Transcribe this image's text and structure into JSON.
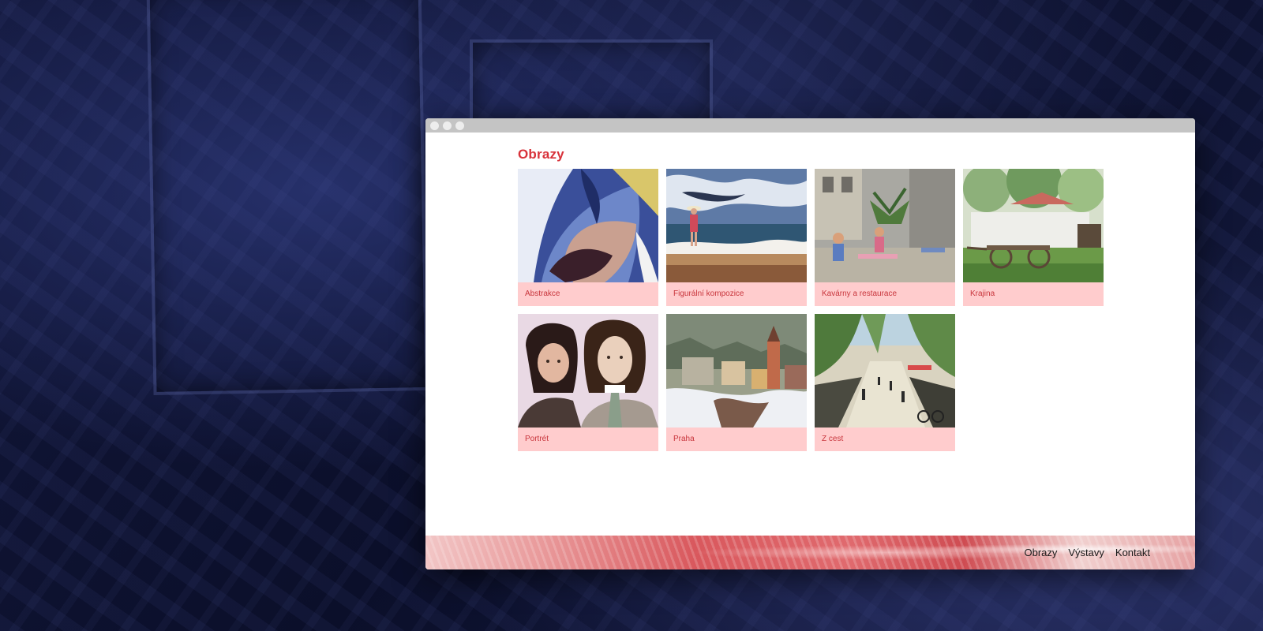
{
  "page": {
    "title": "Obrazy"
  },
  "gallery": {
    "items": [
      {
        "label": "Abstrakce",
        "image": "abstract-painting"
      },
      {
        "label": "Figurální kompozice",
        "image": "beach-figure-painting"
      },
      {
        "label": "Kavárny a restaurace",
        "image": "cafe-painting"
      },
      {
        "label": "Krajina",
        "image": "landscape-painting"
      },
      {
        "label": "Portrét",
        "image": "portrait-painting"
      },
      {
        "label": "Praha",
        "image": "prague-painting"
      },
      {
        "label": "Z cest",
        "image": "travel-street-painting"
      }
    ]
  },
  "footer": {
    "nav": [
      {
        "label": "Obrazy"
      },
      {
        "label": "Výstavy"
      },
      {
        "label": "Kontakt"
      }
    ]
  },
  "colors": {
    "accent": "#d8323a",
    "caption_bg": "#ffcccd",
    "caption_text": "#c8353c",
    "titlebar": "#c4c4c4",
    "background": "#12173a"
  }
}
